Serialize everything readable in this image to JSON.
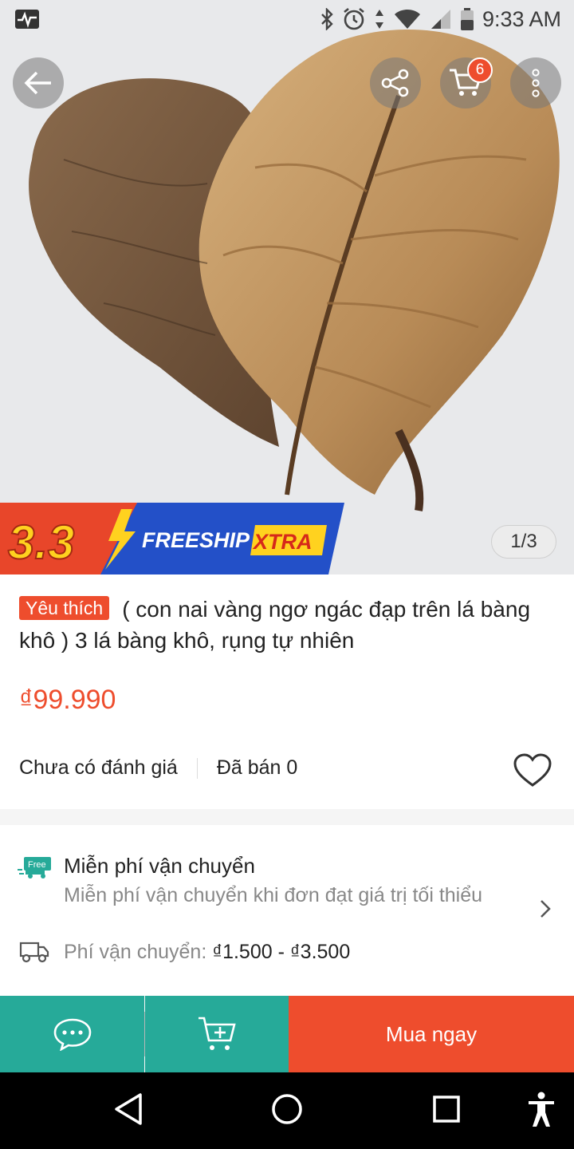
{
  "status_bar": {
    "time": "9:33 AM",
    "icons": [
      "pulse-icon",
      "bluetooth-icon",
      "alarm-icon",
      "data-arrows-icon",
      "wifi-icon",
      "signal-icon",
      "battery-icon"
    ]
  },
  "top_actions": {
    "cart_count": "6",
    "icons": [
      "back-arrow-icon",
      "share-icon",
      "cart-icon",
      "more-vert-icon"
    ]
  },
  "promo_banner": {
    "event": "3.3",
    "freeship": "FREESHIP",
    "xtra": "XTRA"
  },
  "image_counter": "1/3",
  "product": {
    "tag": "Yêu thích",
    "title": "( con nai vàng ngơ ngác đạp trên lá bàng khô ) 3 lá bàng khô, rụng tự nhiên",
    "price": "₫99.990",
    "rating_text": "Chưa có đánh giá",
    "sold_text": "Đã bán 0"
  },
  "shipping": {
    "free_badge": "Free",
    "heading": "Miễn phí vận chuyển",
    "subtext": "Miễn phí vận chuyển khi đơn đạt giá trị tối thiểu",
    "fee_label": "Phí vận chuyển: ",
    "fee_value": "₫1.500 - ₫3.500"
  },
  "bottom_bar": {
    "buy_now": "Mua ngay"
  },
  "colors": {
    "accent": "#ee4d2d",
    "teal": "#26aa99"
  }
}
